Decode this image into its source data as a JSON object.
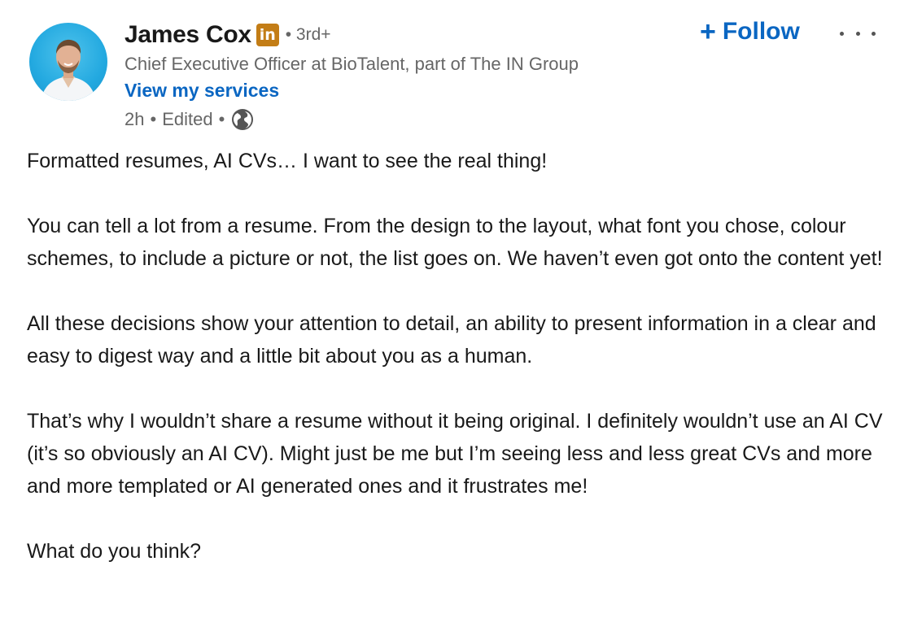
{
  "author": {
    "name": "James Cox",
    "badge": "in",
    "degree": "• 3rd+",
    "headline": "Chief Executive Officer at BioTalent, part of The IN Group",
    "services_link": "View my services"
  },
  "meta": {
    "time": "2h",
    "separator": "•",
    "edited": "Edited",
    "visibility_icon": "globe-icon"
  },
  "actions": {
    "follow_plus": "+",
    "follow_label": "Follow",
    "more_icon": "more-horizontal-icon"
  },
  "post": {
    "paragraphs": [
      "Formatted resumes, AI CVs… I want to see the real thing!",
      "You can tell a lot from a resume. From the design to the layout, what font you chose, colour schemes, to include a picture or not, the list goes on. We haven’t even got onto the content yet!",
      "All these decisions show your attention to detail, an ability to present information in a clear and easy to digest way and a little bit about you as a human.",
      "That’s why I wouldn’t share a resume without it being original. I definitely wouldn’t use an AI CV (it’s so obviously an AI CV). Might just be me but I’m seeing less and less great CVs and more and more templated or AI generated ones and it frustrates me!",
      "What do you think?"
    ]
  },
  "colors": {
    "link_blue": "#0a66c2",
    "premium_gold": "#c37d16",
    "secondary_text": "#666666",
    "primary_text": "#191919"
  }
}
